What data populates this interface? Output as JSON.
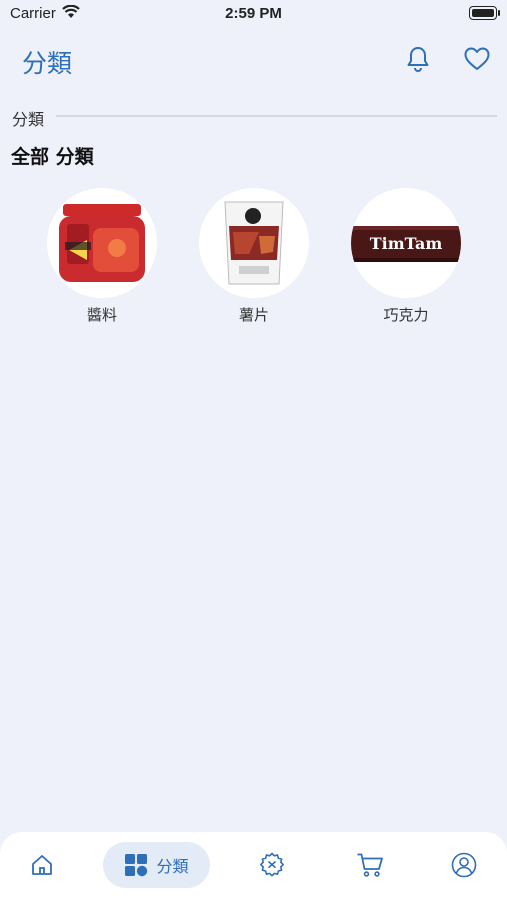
{
  "status_bar": {
    "carrier": "Carrier",
    "time": "2:59 PM"
  },
  "header": {
    "title": "分類",
    "icons": [
      "bell-icon",
      "heart-icon"
    ]
  },
  "section": {
    "label": "分類",
    "all_title": "全部 分類"
  },
  "categories": [
    {
      "label": "醬料",
      "image": "doritos-salsa-jar"
    },
    {
      "label": "薯片",
      "image": "chips-bag"
    },
    {
      "label": "巧克力",
      "image": "timtam-pack",
      "image_text": "TimTam"
    }
  ],
  "tabbar": {
    "items": [
      {
        "icon": "home-icon"
      },
      {
        "icon": "grid-icon",
        "label": "分類",
        "active": true
      },
      {
        "icon": "badge-icon"
      },
      {
        "icon": "cart-icon"
      },
      {
        "icon": "user-icon"
      }
    ]
  },
  "colors": {
    "accent": "#2f6fb8",
    "background": "#eef1fa",
    "active_tab_bg": "#e3ebf7"
  }
}
